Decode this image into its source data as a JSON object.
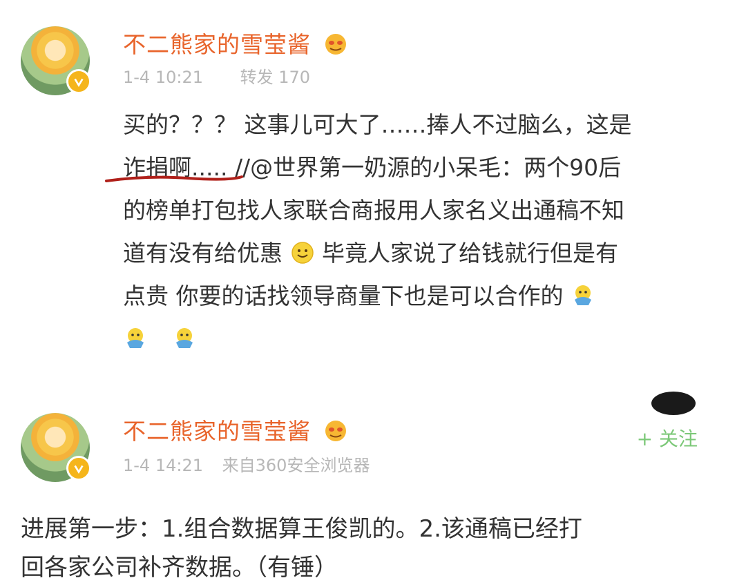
{
  "posts": [
    {
      "username": "不二熊家的雪莹酱",
      "time": "1-4 10:21",
      "repost": "转发 170",
      "body": {
        "line1": "买的？？？ 这事儿可大了……捧人不过脑么，这是",
        "line2_a": "诈捐啊.....",
        "line2_b": " //@世界第一奶源的小呆毛：两个90后",
        "line3": "的榜单打包找人家联合商报用人家名义出通稿不知",
        "line4_a": "道有没有给优惠",
        "line4_b": " 毕竟人家说了给钱就行但是有",
        "line5": "点贵 你要的话找领导商量下也是可以合作的"
      }
    },
    {
      "username": "不二熊家的雪莹酱",
      "time": "1-4 14:21",
      "source": "来自360安全浏览器",
      "follow_label": "+ 关注",
      "body": {
        "line1": "进展第一步：1.组合数据算王俊凯的。2.该通稿已经打",
        "line2": "回各家公司补齐数据。（有锤）"
      }
    }
  ],
  "icons": {
    "avatar": "avatar-icon",
    "verified_badge": "verified-badge-icon",
    "emoji_smile": "smile-emoji-icon",
    "emoji_doge": "doge-emoji-icon",
    "vip_face": "vip-face-icon"
  },
  "colors": {
    "username": "#e8642b",
    "meta": "#b7b7b7",
    "body": "#333333",
    "follow": "#7cc878",
    "underline": "#b0201a"
  }
}
